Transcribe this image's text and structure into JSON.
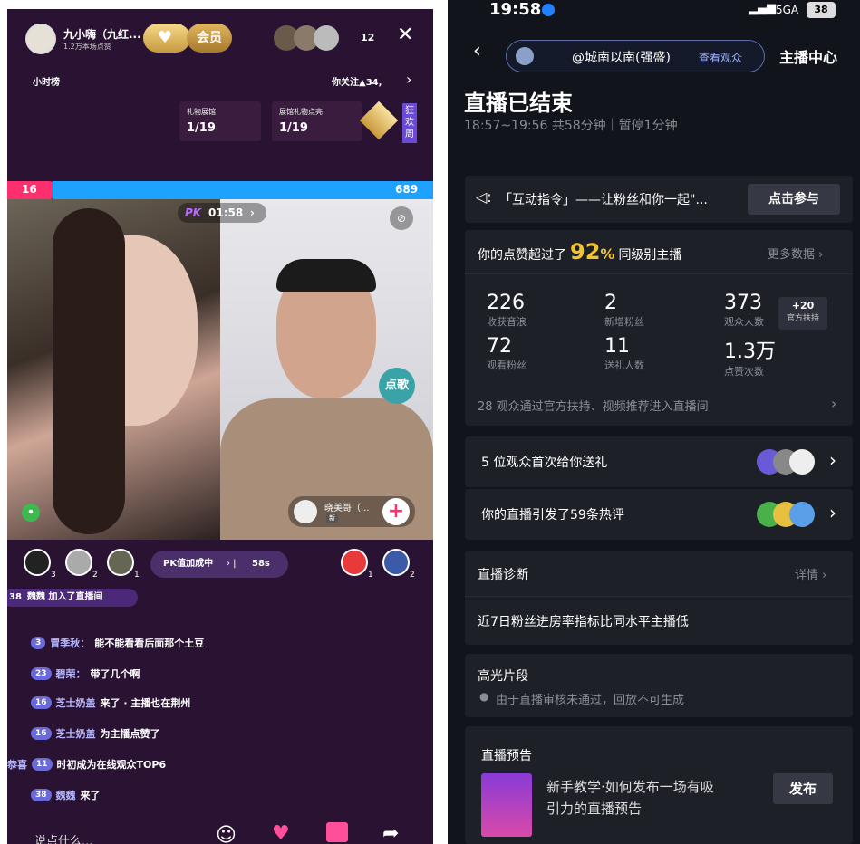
{
  "left": {
    "host": {
      "name": "九小嗨（九红...",
      "likes": "1.2万本场点赞",
      "vip": "会员"
    },
    "viewers": "12",
    "hourly_rank": "小时榜",
    "follow": "你关注▲34,",
    "gift_hall": {
      "label": "礼物展馆",
      "value": "1/19"
    },
    "gift_light": {
      "label": "展馆礼物点亮",
      "value": "1/19"
    },
    "carnival": "狂欢周",
    "pk_score_left": "16",
    "pk_score_right": "689",
    "pk_timer": "01:58",
    "pk_logo": "PK",
    "song_button": "点歌",
    "guest_name": "晓美哥（...",
    "guest_tag": "新",
    "rank_counts": [
      "3",
      "2",
      "1"
    ],
    "pk_status": "PK值加成中",
    "pk_countdown": "58s",
    "right_rank_counts": [
      "1",
      "2"
    ],
    "join_msg": {
      "level": "38",
      "text": "魏魏 加入了直播间"
    },
    "chat": [
      {
        "level": "3",
        "user": "冒季秋：",
        "text": "能不能看看后面那个土豆"
      },
      {
        "level": "23",
        "user": "碧荣：",
        "text": "带了几个啊"
      },
      {
        "level": "16",
        "user": "芝士奶盖",
        "text": "来了 · 主播也在荆州"
      },
      {
        "level": "16",
        "user": "芝士奶盖",
        "text": "为主播点赞了"
      },
      {
        "level": "11",
        "user": "恭喜",
        "text": "时初成为在线观众TOP6"
      },
      {
        "level": "38",
        "user": "魏魏",
        "text": "来了"
      }
    ],
    "input_placeholder": "说点什么..."
  },
  "right": {
    "status_time": "19:58",
    "network": "5GA",
    "battery": "38",
    "account": "@城南以南(强盛)",
    "view_audience": "查看观众",
    "anchor_center": "主播中心",
    "title": "直播已结束",
    "duration": "18:57~19:56 共58分钟｜暂停1分钟",
    "interaction": {
      "text": "「互动指令」——让粉丝和你一起\"...",
      "button": "点击参与"
    },
    "likes_beat": {
      "prefix": "你的点赞超过了",
      "percent": "92",
      "percent_sign": "%",
      "suffix": "同级别主播",
      "more": "更多数据"
    },
    "stats": [
      {
        "num": "226",
        "label": "收获音浪"
      },
      {
        "num": "2",
        "label": "新增粉丝"
      },
      {
        "num": "373",
        "label": "观众人数"
      },
      {
        "num": "72",
        "label": "观看粉丝"
      },
      {
        "num": "11",
        "label": "送礼人数"
      },
      {
        "num": "1.3万",
        "label": "点赞次数"
      }
    ],
    "official_support": {
      "plus": "+20",
      "label": "官方扶持"
    },
    "source_note": "28 观众通过官方扶持、视频推荐进入直播间",
    "first_gift": "5 位观众首次给你送礼",
    "hot_comments": "你的直播引发了59条热评",
    "diagnosis": {
      "title": "直播诊断",
      "detail": "详情",
      "text": "近7日粉丝进房率指标比同水平主播低"
    },
    "highlights": {
      "title": "高光片段",
      "note": "由于直播审核未通过，回放不可生成"
    },
    "preview": {
      "title": "直播预告",
      "text_line1": "新手教学·如何发布一场有吸",
      "text_line2": "引力的直播预告",
      "button": "发布"
    }
  }
}
